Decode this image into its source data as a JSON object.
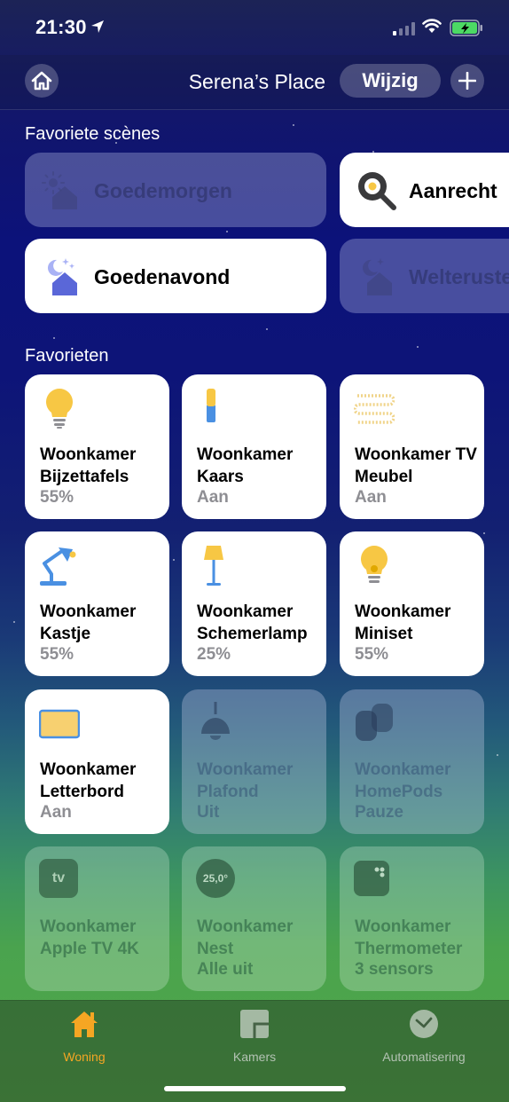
{
  "status_bar": {
    "time": "21:30"
  },
  "nav": {
    "title": "Serena’s Place",
    "edit_label": "Wijzig"
  },
  "sections": {
    "scenes_title": "Favoriete scènes",
    "favorites_title": "Favorieten"
  },
  "scenes": [
    {
      "label": "Goedemorgen",
      "active": false,
      "icon": "sun-house-icon"
    },
    {
      "label": "Aanrecht",
      "active": true,
      "icon": "frying-pan-icon"
    },
    {
      "label": "Goedenavond",
      "active": true,
      "icon": "moon-house-icon"
    },
    {
      "label": "Welteruste",
      "active": false,
      "icon": "moon-house-icon"
    }
  ],
  "accessories": [
    {
      "name": "Woonkamer Bijzettafels",
      "state": "55%",
      "active": true,
      "icon": "lightbulb-icon"
    },
    {
      "name": "Woonkamer Kaars",
      "state": "Aan",
      "active": true,
      "icon": "candle-icon"
    },
    {
      "name": "Woonkamer TV Meubel",
      "state": "Aan",
      "active": true,
      "icon": "light-strip-icon"
    },
    {
      "name": "Woonkamer Kastje",
      "state": "55%",
      "active": true,
      "icon": "desk-lamp-icon"
    },
    {
      "name": "Woonkamer Schemerlamp",
      "state": "25%",
      "active": true,
      "icon": "floor-lamp-icon"
    },
    {
      "name": "Woonkamer Miniset",
      "state": "55%",
      "active": true,
      "icon": "lightbulb-icon"
    },
    {
      "name": "Woonkamer Letterbord",
      "state": "Aan",
      "active": true,
      "icon": "letterboard-icon"
    },
    {
      "name": "Woonkamer Plafond",
      "state": "Uit",
      "active": false,
      "icon": "ceiling-lamp-icon"
    },
    {
      "name": "Woonkamer HomePods",
      "state": "Pauze",
      "active": false,
      "icon": "homepod-icon"
    },
    {
      "name": "Woonkamer Apple TV 4K",
      "state": "",
      "active": false,
      "icon": "apple-tv-icon",
      "badge": "tv"
    },
    {
      "name": "Woonkamer Nest",
      "state": "Alle uit",
      "active": false,
      "icon": "thermostat-icon",
      "badge": "25,0°"
    },
    {
      "name": "Woonkamer Thermometer",
      "state": "3 sensors",
      "active": false,
      "icon": "sensor-icon"
    }
  ],
  "tabs": [
    {
      "label": "Woning",
      "active": true
    },
    {
      "label": "Kamers",
      "active": false
    },
    {
      "label": "Automatisering",
      "active": false
    }
  ],
  "colors": {
    "accent": "#f5a623",
    "bulb": "#f7c744",
    "scene_icon": "#5a67d8"
  }
}
